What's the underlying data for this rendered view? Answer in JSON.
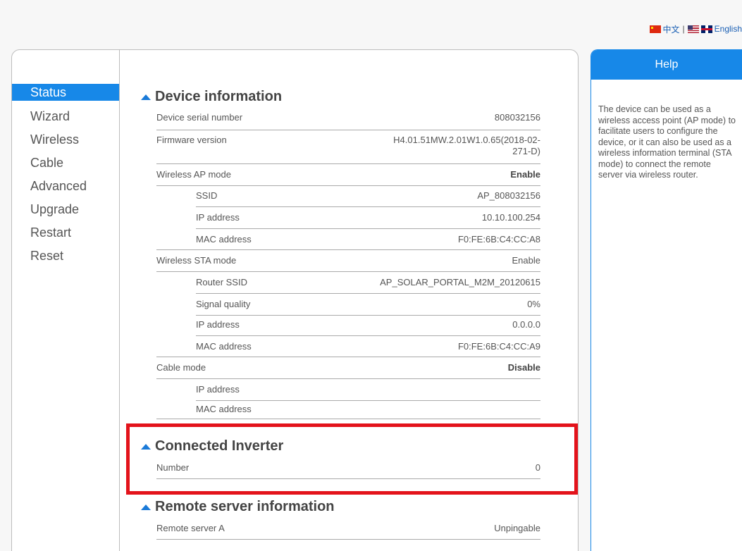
{
  "language": {
    "chinese": "中文",
    "separator": "|",
    "english": "English"
  },
  "nav": {
    "items": [
      "Status",
      "Wizard",
      "Wireless",
      "Cable",
      "Advanced",
      "Upgrade",
      "Restart",
      "Reset"
    ],
    "active": "Status"
  },
  "device_info": {
    "title": "Device information",
    "serial_label": "Device serial number",
    "serial_value": "808032156",
    "firmware_label": "Firmware version",
    "firmware_value_line1": "H4.01.51MW.2.01W1.0.65(2018-02-",
    "firmware_value_line2": "271-D)",
    "ap_mode_label": "Wireless AP mode",
    "ap_mode_value": "Enable",
    "ap_ssid_label": "SSID",
    "ap_ssid_value": "AP_808032156",
    "ap_ip_label": "IP address",
    "ap_ip_value": "10.10.100.254",
    "ap_mac_label": "MAC address",
    "ap_mac_value": "F0:FE:6B:C4:CC:A8",
    "sta_mode_label": "Wireless STA mode",
    "sta_mode_value": "Enable",
    "sta_ssid_label": "Router SSID",
    "sta_ssid_value": "AP_SOLAR_PORTAL_M2M_20120615",
    "sta_signal_label": "Signal quality",
    "sta_signal_value": "0%",
    "sta_ip_label": "IP address",
    "sta_ip_value": "0.0.0.0",
    "sta_mac_label": "MAC address",
    "sta_mac_value": "F0:FE:6B:C4:CC:A9",
    "cable_mode_label": "Cable mode",
    "cable_mode_value": "Disable",
    "cable_ip_label": "IP address",
    "cable_mac_label": "MAC address"
  },
  "inverter": {
    "title": "Connected Inverter",
    "number_label": "Number",
    "number_value": "0"
  },
  "remote": {
    "title": "Remote server information",
    "server_a_label": "Remote server A",
    "server_a_value": "Unpingable"
  },
  "help": {
    "title": "Help",
    "text": "The device can be used as a wireless access point (AP mode) to facilitate users to configure the device, or it can also be used as a wireless information terminal (STA mode) to connect the remote server via wireless router."
  },
  "colors": {
    "accent": "#1788e8",
    "highlight": "#e3131b"
  }
}
